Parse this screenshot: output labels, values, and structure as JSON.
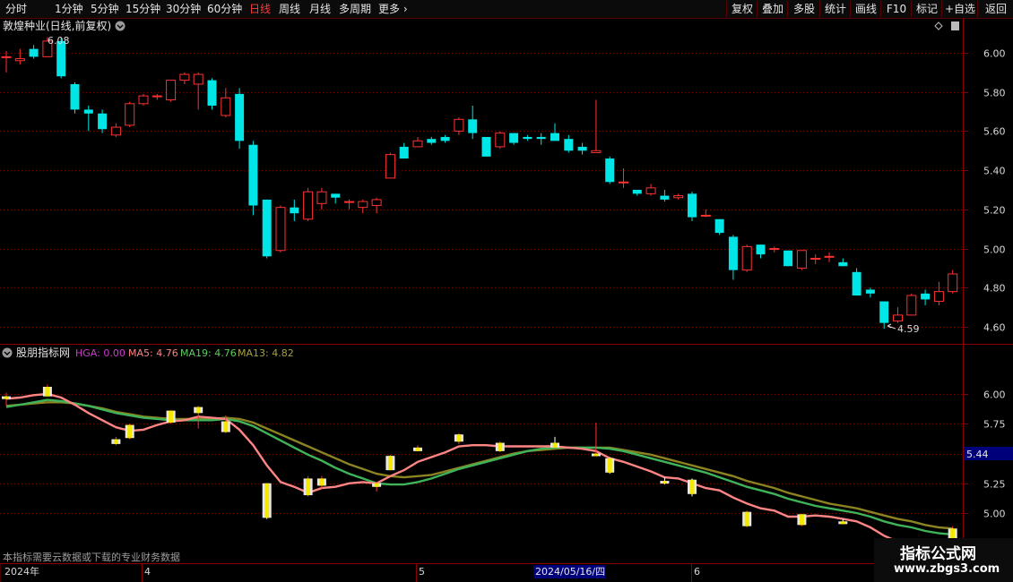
{
  "toolbar": {
    "periods": [
      "分时",
      "1分钟",
      "5分钟",
      "15分钟",
      "30分钟",
      "60分钟",
      "日线",
      "周线",
      "月线",
      "多周期",
      "更多 ›"
    ],
    "active_period": "日线",
    "right_buttons": [
      "复权",
      "叠加",
      "多股",
      "统计",
      "画线",
      "F10",
      "+自选",
      "返回"
    ]
  },
  "main_panel": {
    "title": "敦煌种业(日线,前复权)",
    "y_ticks": [
      "6.00",
      "5.80",
      "5.60",
      "5.40",
      "5.20",
      "5.00",
      "4.80",
      "4.60"
    ],
    "high_label": "6.08",
    "low_label": "4.59"
  },
  "indicator_panel": {
    "name": "股朋指标网",
    "legend": [
      {
        "label": "HGA: 0.00",
        "color": "#d23cd2"
      },
      {
        "label": "MA5: 4.76",
        "color": "#ff8080"
      },
      {
        "label": "MA19: 4.76",
        "color": "#5ccc5c"
      },
      {
        "label": "MA13: 4.82",
        "color": "#a8a040"
      }
    ],
    "y_ticks": [
      "6.00",
      "5.75",
      "5.50",
      "5.25",
      "5.00"
    ],
    "cursor_value": "5.44",
    "notice": "本指标需要云数据或下载的专业财务数据"
  },
  "x_axis": {
    "labels": [
      "2024年",
      "4",
      "5",
      "2024/05/16/四",
      "6"
    ]
  },
  "watermark": {
    "line1": "指标公式网",
    "line2": "www.zbgs3.com"
  },
  "colors": {
    "up": "#ff3232",
    "down": "#00e5e5",
    "grid": "#7a0000",
    "axis_text": "#d8d8d8"
  },
  "chart_data": {
    "type": "candlestick",
    "candles": [
      [
        5.98,
        5.98,
        6.01,
        5.9
      ],
      [
        5.96,
        5.97,
        6.02,
        5.94
      ],
      [
        6.02,
        5.98,
        6.04,
        5.97
      ],
      [
        5.98,
        6.06,
        6.08,
        5.98
      ],
      [
        6.06,
        5.88,
        6.08,
        5.87
      ],
      [
        5.84,
        5.71,
        5.85,
        5.69
      ],
      [
        5.71,
        5.69,
        5.73,
        5.6
      ],
      [
        5.69,
        5.61,
        5.71,
        5.59
      ],
      [
        5.58,
        5.62,
        5.64,
        5.57
      ],
      [
        5.63,
        5.74,
        5.75,
        5.62
      ],
      [
        5.74,
        5.78,
        5.79,
        5.73
      ],
      [
        5.78,
        5.78,
        5.79,
        5.76
      ],
      [
        5.76,
        5.86,
        5.86,
        5.75
      ],
      [
        5.86,
        5.89,
        5.9,
        5.84
      ],
      [
        5.84,
        5.89,
        5.9,
        5.71
      ],
      [
        5.86,
        5.73,
        5.87,
        5.71
      ],
      [
        5.68,
        5.77,
        5.82,
        5.67
      ],
      [
        5.79,
        5.55,
        5.82,
        5.51
      ],
      [
        5.53,
        5.22,
        5.55,
        5.17
      ],
      [
        5.25,
        4.96,
        5.25,
        4.95
      ],
      [
        4.99,
        5.21,
        5.22,
        4.98
      ],
      [
        5.21,
        5.18,
        5.25,
        5.14
      ],
      [
        5.15,
        5.29,
        5.31,
        5.14
      ],
      [
        5.23,
        5.29,
        5.31,
        5.2
      ],
      [
        5.28,
        5.26,
        5.28,
        5.23
      ],
      [
        5.24,
        5.24,
        5.25,
        5.2
      ],
      [
        5.21,
        5.24,
        5.25,
        5.18
      ],
      [
        5.22,
        5.25,
        5.26,
        5.18
      ],
      [
        5.36,
        5.48,
        5.49,
        5.36
      ],
      [
        5.52,
        5.46,
        5.54,
        5.46
      ],
      [
        5.52,
        5.55,
        5.57,
        5.52
      ],
      [
        5.56,
        5.54,
        5.57,
        5.53
      ],
      [
        5.57,
        5.55,
        5.58,
        5.54
      ],
      [
        5.6,
        5.66,
        5.67,
        5.58
      ],
      [
        5.66,
        5.59,
        5.73,
        5.56
      ],
      [
        5.57,
        5.47,
        5.57,
        5.47
      ],
      [
        5.52,
        5.59,
        5.6,
        5.51
      ],
      [
        5.59,
        5.54,
        5.58,
        5.53
      ],
      [
        5.57,
        5.56,
        5.58,
        5.55
      ],
      [
        5.57,
        5.56,
        5.59,
        5.53
      ],
      [
        5.59,
        5.55,
        5.64,
        5.55
      ],
      [
        5.56,
        5.5,
        5.58,
        5.49
      ],
      [
        5.52,
        5.5,
        5.54,
        5.48
      ],
      [
        5.49,
        5.5,
        5.76,
        5.5
      ],
      [
        5.46,
        5.34,
        5.47,
        5.33
      ],
      [
        5.34,
        5.34,
        5.41,
        5.31
      ],
      [
        5.3,
        5.28,
        5.3,
        5.27
      ],
      [
        5.28,
        5.31,
        5.33,
        5.27
      ],
      [
        5.27,
        5.25,
        5.3,
        5.24
      ],
      [
        5.26,
        5.27,
        5.28,
        5.25
      ],
      [
        5.28,
        5.16,
        5.29,
        5.14
      ],
      [
        5.17,
        5.17,
        5.2,
        5.16
      ],
      [
        5.15,
        5.08,
        5.15,
        5.07
      ],
      [
        5.06,
        4.89,
        5.07,
        4.84
      ],
      [
        4.89,
        5.01,
        5.02,
        4.88
      ],
      [
        5.02,
        4.97,
        5.02,
        4.95
      ],
      [
        5.0,
        5.0,
        5.01,
        4.98
      ],
      [
        4.99,
        4.91,
        4.99,
        4.91
      ],
      [
        4.9,
        4.99,
        4.99,
        4.89
      ],
      [
        4.95,
        4.95,
        4.97,
        4.92
      ],
      [
        4.96,
        4.96,
        4.98,
        4.93
      ],
      [
        4.93,
        4.91,
        4.95,
        4.91
      ],
      [
        4.88,
        4.76,
        4.9,
        4.76
      ],
      [
        4.79,
        4.77,
        4.8,
        4.75
      ],
      [
        4.73,
        4.62,
        4.73,
        4.59
      ],
      [
        4.63,
        4.66,
        4.7,
        4.62
      ],
      [
        4.66,
        4.76,
        4.77,
        4.66
      ],
      [
        4.77,
        4.74,
        4.79,
        4.71
      ],
      [
        4.73,
        4.78,
        4.83,
        4.71
      ],
      [
        4.78,
        4.87,
        4.89,
        4.77
      ]
    ],
    "ylim": [
      4.55,
      6.1
    ],
    "indicator_ylim": [
      4.9,
      6.1
    ],
    "ma5": [
      5.96,
      5.97,
      5.99,
      6.0,
      5.97,
      5.91,
      5.84,
      5.78,
      5.72,
      5.69,
      5.7,
      5.74,
      5.77,
      5.78,
      5.81,
      5.8,
      5.79,
      5.7,
      5.57,
      5.4,
      5.26,
      5.22,
      5.17,
      5.21,
      5.22,
      5.25,
      5.26,
      5.25,
      5.31,
      5.36,
      5.43,
      5.47,
      5.51,
      5.56,
      5.57,
      5.57,
      5.56,
      5.56,
      5.56,
      5.56,
      5.56,
      5.55,
      5.54,
      5.52,
      5.46,
      5.43,
      5.39,
      5.35,
      5.3,
      5.29,
      5.25,
      5.21,
      5.19,
      5.13,
      5.08,
      5.04,
      5.02,
      4.97,
      4.97,
      4.98,
      4.97,
      4.95,
      4.93,
      4.88,
      4.81,
      4.76,
      4.74,
      4.71,
      4.72,
      4.76
    ],
    "ma19": [
      5.89,
      5.91,
      5.93,
      5.95,
      5.94,
      5.92,
      5.9,
      5.87,
      5.84,
      5.82,
      5.8,
      5.79,
      5.78,
      5.78,
      5.78,
      5.78,
      5.79,
      5.77,
      5.73,
      5.67,
      5.61,
      5.55,
      5.49,
      5.44,
      5.38,
      5.33,
      5.29,
      5.25,
      5.24,
      5.24,
      5.26,
      5.29,
      5.33,
      5.37,
      5.4,
      5.43,
      5.46,
      5.49,
      5.52,
      5.54,
      5.55,
      5.55,
      5.55,
      5.55,
      5.54,
      5.52,
      5.49,
      5.46,
      5.43,
      5.4,
      5.37,
      5.34,
      5.3,
      5.26,
      5.22,
      5.19,
      5.16,
      5.12,
      5.09,
      5.06,
      5.04,
      5.02,
      5.0,
      4.97,
      4.93,
      4.9,
      4.88,
      4.85,
      4.83,
      4.82
    ],
    "ma13": [
      5.9,
      5.91,
      5.92,
      5.93,
      5.93,
      5.92,
      5.9,
      5.88,
      5.85,
      5.83,
      5.81,
      5.8,
      5.79,
      5.79,
      5.79,
      5.79,
      5.8,
      5.79,
      5.76,
      5.71,
      5.66,
      5.61,
      5.56,
      5.51,
      5.46,
      5.41,
      5.37,
      5.33,
      5.31,
      5.3,
      5.31,
      5.32,
      5.35,
      5.38,
      5.41,
      5.44,
      5.47,
      5.5,
      5.52,
      5.53,
      5.54,
      5.55,
      5.55,
      5.55,
      5.55,
      5.53,
      5.51,
      5.49,
      5.46,
      5.43,
      5.4,
      5.37,
      5.34,
      5.31,
      5.27,
      5.24,
      5.21,
      5.17,
      5.14,
      5.11,
      5.08,
      5.06,
      5.04,
      5.01,
      4.98,
      4.95,
      4.93,
      4.9,
      4.88,
      4.87
    ]
  }
}
